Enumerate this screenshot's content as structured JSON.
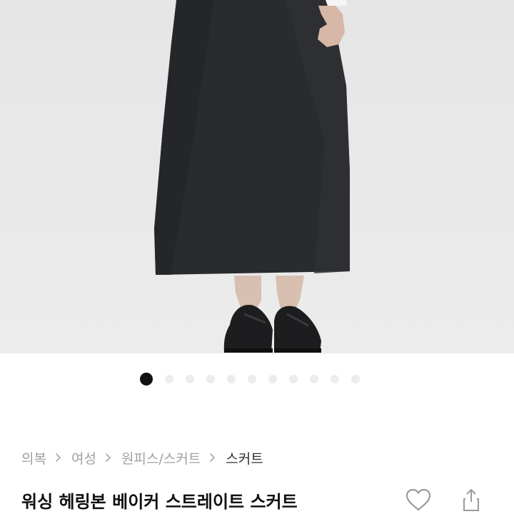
{
  "product": {
    "image_alt": "skirt-photo",
    "image_count": 11,
    "active_image": 1,
    "title": "워싱 헤링본 베이커 스트레이트 스커트"
  },
  "breadcrumb": {
    "items": [
      {
        "label": "의복"
      },
      {
        "label": "여성"
      },
      {
        "label": "원피스/스커트"
      },
      {
        "label": "스커트"
      }
    ]
  },
  "actions": {
    "like_icon": "heart-outline-icon",
    "share_icon": "share-icon"
  },
  "colors": {
    "text_primary": "#111111",
    "text_muted": "#a0a0a0",
    "dot_active": "#111111",
    "dot_inactive": "#ececec"
  }
}
